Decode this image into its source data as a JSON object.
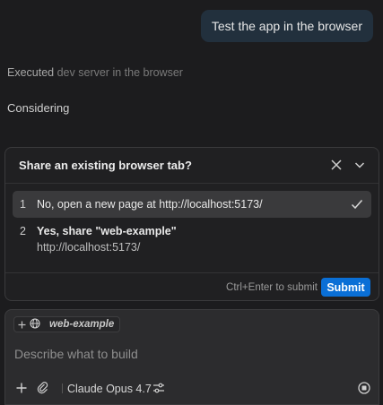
{
  "user_message": "Test the app in the browser",
  "status": {
    "executed_prefix": "Executed",
    "executed_detail": "dev server in the browser",
    "considering": "Considering"
  },
  "dialog": {
    "title": "Share an existing browser tab?",
    "options": [
      {
        "number": "1",
        "label": "No, open a new page at http://localhost:5173/",
        "selected": true
      },
      {
        "number": "2",
        "label": "Yes, share \"web-example\"",
        "sublabel": "http://localhost:5173/",
        "selected": false
      }
    ],
    "shortcut_hint": "Ctrl+Enter to submit",
    "submit_label": "Submit"
  },
  "composer": {
    "context_chip": "web-example",
    "placeholder": "Describe what to build",
    "model": "Claude Opus 4.7"
  },
  "colors": {
    "background": "#1c1c1e",
    "user_bubble": "#22303d",
    "selected_option": "#3a3a3c",
    "accent": "#0a6fd6"
  },
  "icons": [
    "close-icon",
    "chevron-down-icon",
    "check-icon",
    "plus-icon",
    "globe-icon",
    "attach-icon",
    "settings-sliders-icon",
    "stop-icon"
  ]
}
